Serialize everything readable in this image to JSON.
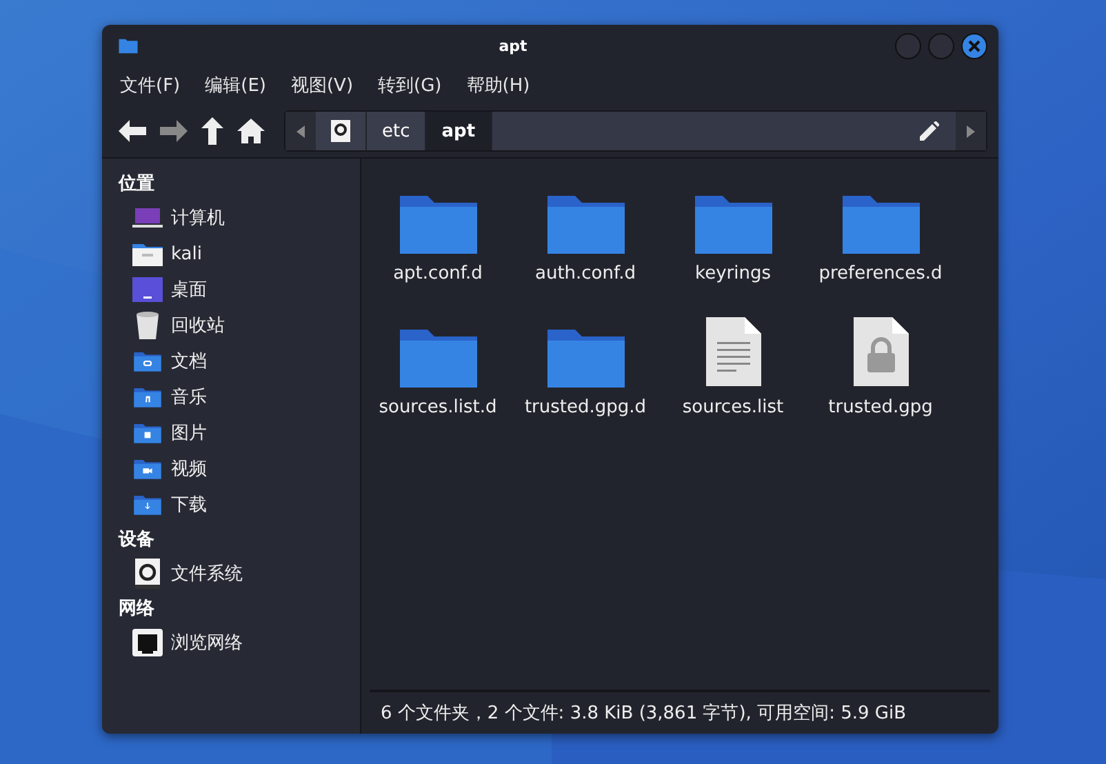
{
  "window": {
    "title": "apt"
  },
  "menu": [
    "文件(F)",
    "编辑(E)",
    "视图(V)",
    "转到(G)",
    "帮助(H)"
  ],
  "path": [
    {
      "kind": "drive",
      "selected": false
    },
    {
      "kind": "text",
      "label": "etc",
      "selected": false
    },
    {
      "kind": "text",
      "label": "apt",
      "selected": true
    }
  ],
  "sidebar": [
    {
      "heading": "位置",
      "items": [
        {
          "kind": "computer",
          "label": "计算机"
        },
        {
          "kind": "home",
          "label": "kali"
        },
        {
          "kind": "desktop",
          "label": "桌面"
        },
        {
          "kind": "trash",
          "label": "回收站"
        },
        {
          "kind": "documents",
          "label": "文档"
        },
        {
          "kind": "music",
          "label": "音乐"
        },
        {
          "kind": "pictures",
          "label": "图片"
        },
        {
          "kind": "videos",
          "label": "视频"
        },
        {
          "kind": "downloads",
          "label": "下载"
        }
      ]
    },
    {
      "heading": "设备",
      "items": [
        {
          "kind": "drive",
          "label": "文件系统"
        }
      ]
    },
    {
      "heading": "网络",
      "items": [
        {
          "kind": "network",
          "label": "浏览网络"
        }
      ]
    }
  ],
  "files": [
    {
      "kind": "folder",
      "name": "apt.conf.d"
    },
    {
      "kind": "folder",
      "name": "auth.conf.d"
    },
    {
      "kind": "folder",
      "name": "keyrings"
    },
    {
      "kind": "folder",
      "name": "preferences.d"
    },
    {
      "kind": "folder",
      "name": "sources.list.d"
    },
    {
      "kind": "folder",
      "name": "trusted.gpg.d"
    },
    {
      "kind": "text",
      "name": "sources.list"
    },
    {
      "kind": "locked",
      "name": "trusted.gpg"
    }
  ],
  "status_bar": "6 个文件夹，2 个文件: 3.8 KiB (3,861 字节), 可用空间: 5.9 GiB"
}
